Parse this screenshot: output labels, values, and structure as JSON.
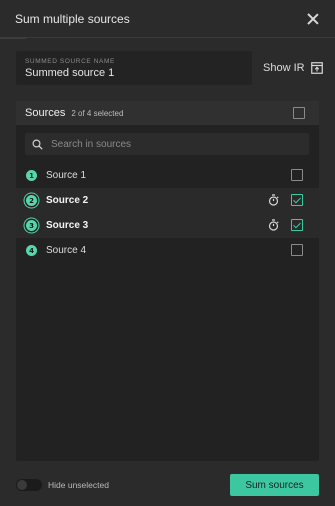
{
  "dialog": {
    "title": "Sum multiple sources"
  },
  "name_field": {
    "label": "SUMMED SOURCE NAME",
    "value": "Summed source 1"
  },
  "show_ir": {
    "label": "Show IR"
  },
  "panel": {
    "title": "Sources",
    "count": "2 of 4 selected",
    "all_checked": false
  },
  "search": {
    "placeholder": "Search in sources"
  },
  "sources": [
    {
      "number": "1",
      "label": "Source 1",
      "checked": false
    },
    {
      "number": "2",
      "label": "Source 2",
      "checked": true
    },
    {
      "number": "3",
      "label": "Source 3",
      "checked": true
    },
    {
      "number": "4",
      "label": "Source 4",
      "checked": false
    }
  ],
  "footer": {
    "hide_unselected_label": "Hide unselected",
    "hide_unselected_on": false,
    "sum_button_label": "Sum sources"
  },
  "colors": {
    "accent": "#3dc7a0",
    "badge": "#58d6a9",
    "background": "#2b2b2b",
    "panel": "#222222"
  },
  "icons": {
    "close": "close-icon",
    "show_ir": "export-window-icon",
    "search": "search-icon",
    "timer": "stopwatch-icon"
  }
}
